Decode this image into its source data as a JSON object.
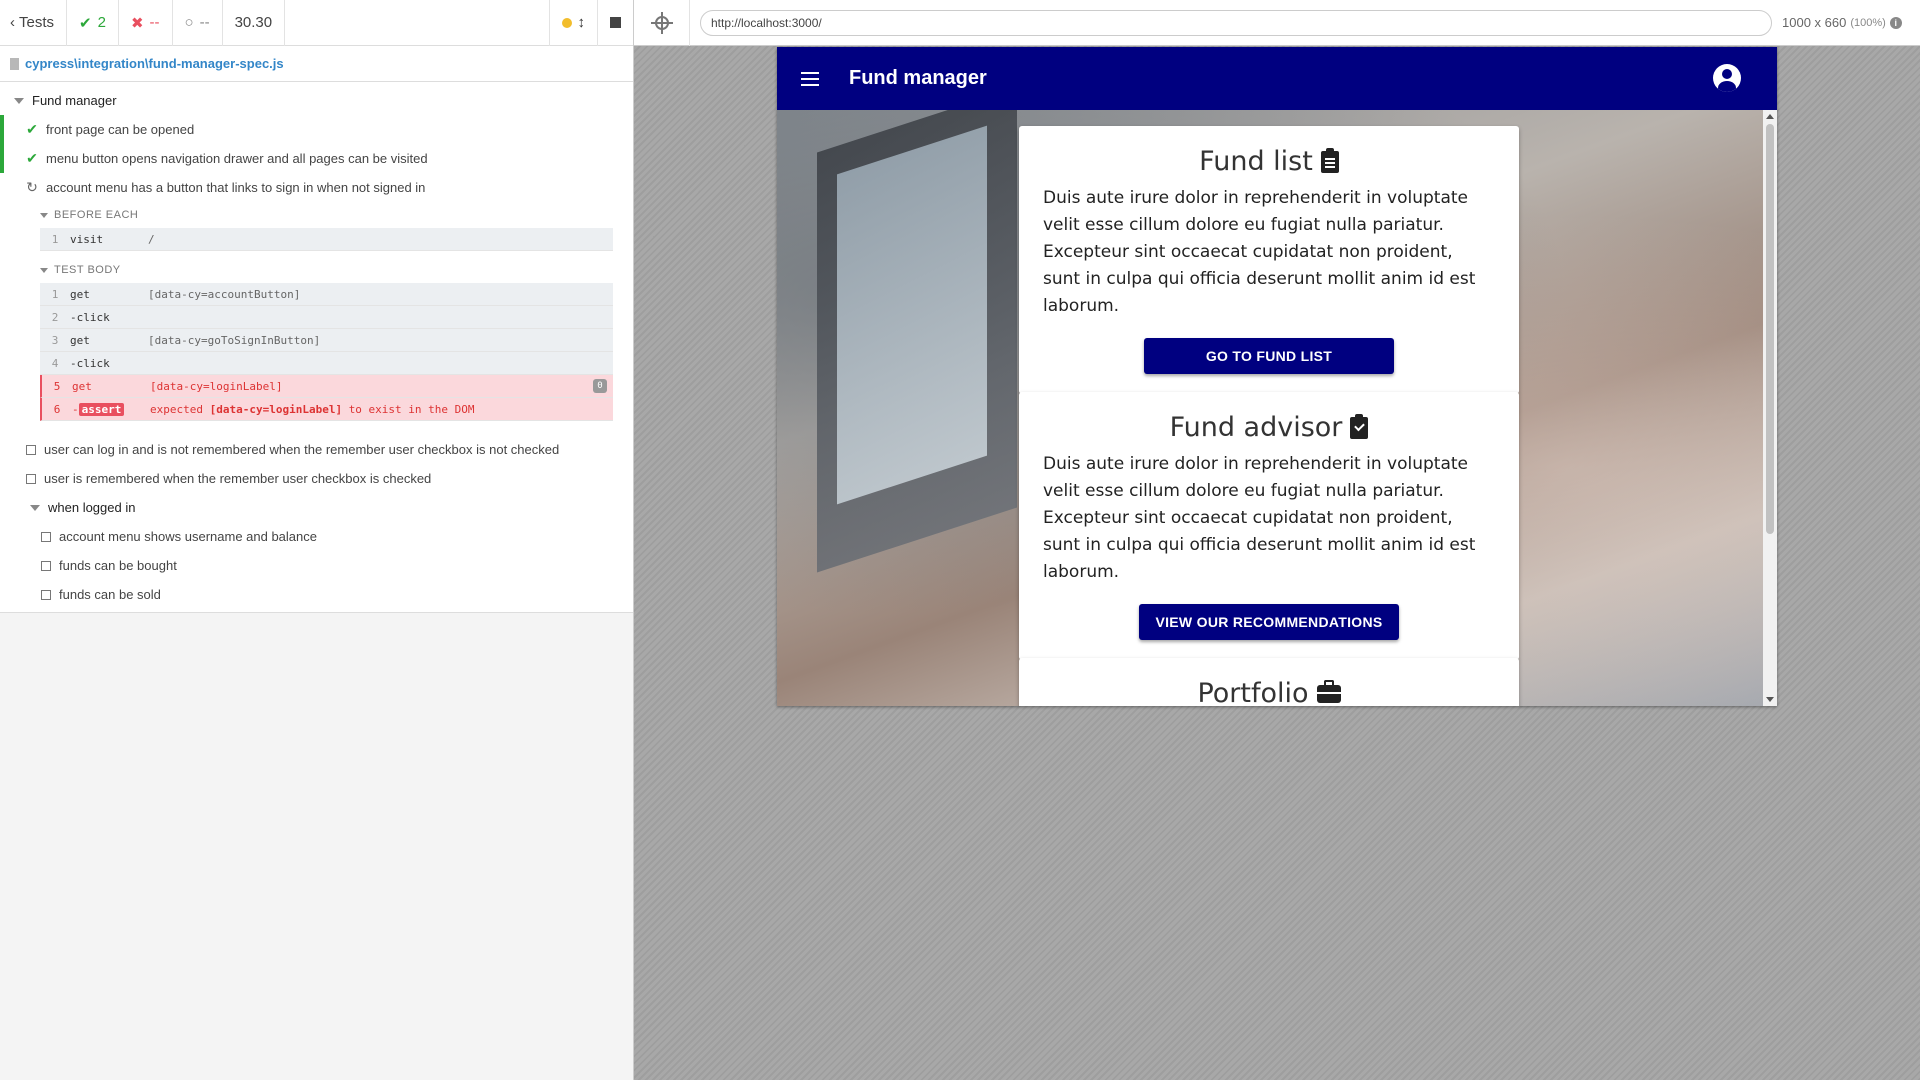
{
  "reporter": {
    "tests_label": "Tests",
    "passed_count": "2",
    "failed_count": "--",
    "pending_count": "--",
    "duration": "30.30",
    "spec_path": "cypress\\integration\\fund-manager-spec.js",
    "suite_title": "Fund manager",
    "tests": [
      {
        "title": "front page can be opened",
        "state": "passed"
      },
      {
        "title": "menu button opens navigation drawer and all pages can be visited",
        "state": "passed"
      },
      {
        "title": "account menu has a button that links to sign in when not signed in",
        "state": "running"
      },
      {
        "title": "user can log in and is not remembered when the remember user checkbox is not checked",
        "state": "pending"
      },
      {
        "title": "user is remembered when the remember user checkbox is checked",
        "state": "pending"
      }
    ],
    "before_each_label": "BEFORE EACH",
    "test_body_label": "TEST BODY",
    "before_each_cmds": [
      {
        "num": "1",
        "name": "visit",
        "msg": "/"
      }
    ],
    "test_body_cmds": [
      {
        "num": "1",
        "name": "get",
        "msg": "[data-cy=accountButton]"
      },
      {
        "num": "2",
        "name": "-click",
        "msg": ""
      },
      {
        "num": "3",
        "name": "get",
        "msg": "[data-cy=goToSignInButton]"
      },
      {
        "num": "4",
        "name": "-click",
        "msg": ""
      },
      {
        "num": "5",
        "name": "get",
        "msg": "[data-cy=loginLabel]",
        "badge": "0"
      },
      {
        "num": "6",
        "name": "assert",
        "msg_prefix": "expected",
        "msg_code": "[data-cy=loginLabel]",
        "msg_suffix": "to exist in the DOM"
      }
    ],
    "nested_suite_title": "when logged in",
    "nested_tests": [
      {
        "title": "account menu shows username and balance",
        "state": "pending"
      },
      {
        "title": "funds can be bought",
        "state": "pending"
      },
      {
        "title": "funds can be sold",
        "state": "pending"
      }
    ]
  },
  "aut": {
    "url": "http://localhost:3000/",
    "viewport_size": "1000 x 660",
    "viewport_scale": "(100%)"
  },
  "app": {
    "title": "Fund manager",
    "cards": [
      {
        "title": "Fund list",
        "icon": "clipboard-list-icon",
        "body": "Duis aute irure dolor in reprehenderit in voluptate velit esse cillum dolore eu fugiat nulla pariatur. Excepteur sint occaecat cupidatat non proident, sunt in culpa qui officia deserunt mollit anim id est laborum.",
        "button": "GO TO FUND LIST"
      },
      {
        "title": "Fund advisor",
        "icon": "clipboard-check-icon",
        "body": "Duis aute irure dolor in reprehenderit in voluptate velit esse cillum dolore eu fugiat nulla pariatur. Excepteur sint occaecat cupidatat non proident, sunt in culpa qui officia deserunt mollit anim id est laborum.",
        "button": "VIEW OUR RECOMMENDATIONS"
      },
      {
        "title": "Portfolio",
        "icon": "briefcase-icon"
      }
    ]
  },
  "colors": {
    "app_bar": "#000080",
    "pass": "#2ca83a",
    "fail": "#e94f5f",
    "link": "#3386c8"
  }
}
